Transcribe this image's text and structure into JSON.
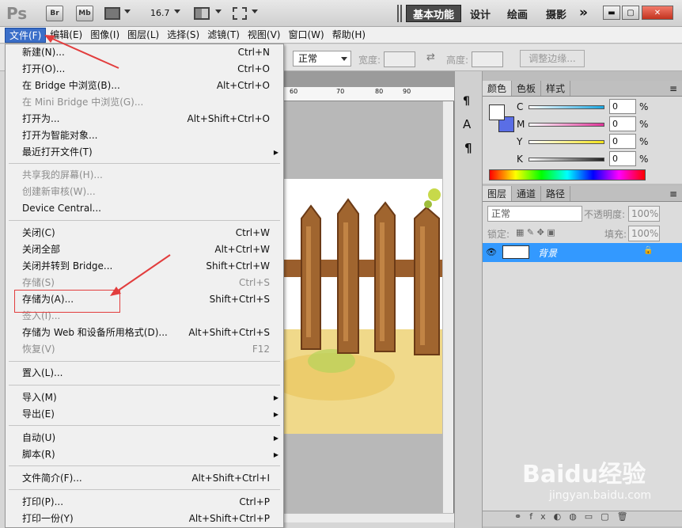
{
  "app": {
    "logo": "Ps",
    "buttons": [
      "Br",
      "Mb"
    ],
    "zoom": "16.7",
    "workspaces": [
      "基本功能",
      "设计",
      "绘画",
      "摄影"
    ],
    "more": "»"
  },
  "menubar": [
    "文件(F)",
    "编辑(E)",
    "图像(I)",
    "图层(L)",
    "选择(S)",
    "滤镜(T)",
    "视图(V)",
    "窗口(W)",
    "帮助(H)"
  ],
  "options": {
    "style_value": "正常",
    "width_label": "宽度:",
    "height_label": "高度:",
    "refine_edge": "调整边缘..."
  },
  "ruler": [
    "60",
    "70",
    "80",
    "90"
  ],
  "file_menu": [
    {
      "label": "新建(N)...",
      "shortcut": "Ctrl+N"
    },
    {
      "label": "打开(O)...",
      "shortcut": "Ctrl+O"
    },
    {
      "label": "在 Bridge 中浏览(B)...",
      "shortcut": "Alt+Ctrl+O"
    },
    {
      "label": "在 Mini Bridge 中浏览(G)...",
      "shortcut": "",
      "disabled": true
    },
    {
      "label": "打开为...",
      "shortcut": "Alt+Shift+Ctrl+O"
    },
    {
      "label": "打开为智能对象...",
      "shortcut": ""
    },
    {
      "label": "最近打开文件(T)",
      "shortcut": "",
      "submenu": true
    },
    {
      "label": "共享我的屏幕(H)...",
      "shortcut": "",
      "disabled": true
    },
    {
      "label": "创建新审核(W)...",
      "shortcut": "",
      "disabled": true
    },
    {
      "label": "Device Central...",
      "shortcut": ""
    },
    {
      "label": "关闭(C)",
      "shortcut": "Ctrl+W"
    },
    {
      "label": "关闭全部",
      "shortcut": "Alt+Ctrl+W"
    },
    {
      "label": "关闭并转到 Bridge...",
      "shortcut": "Shift+Ctrl+W"
    },
    {
      "label": "存储(S)",
      "shortcut": "Ctrl+S",
      "disabled": true
    },
    {
      "label": "存储为(A)...",
      "shortcut": "Shift+Ctrl+S"
    },
    {
      "label": "签入(I)...",
      "shortcut": "",
      "disabled": true
    },
    {
      "label": "存储为 Web 和设备所用格式(D)...",
      "shortcut": "Alt+Shift+Ctrl+S"
    },
    {
      "label": "恢复(V)",
      "shortcut": "F12",
      "disabled": true
    },
    {
      "label": "置入(L)...",
      "shortcut": ""
    },
    {
      "label": "导入(M)",
      "shortcut": "",
      "submenu": true
    },
    {
      "label": "导出(E)",
      "shortcut": "",
      "submenu": true
    },
    {
      "label": "自动(U)",
      "shortcut": "",
      "submenu": true
    },
    {
      "label": "脚本(R)",
      "shortcut": "",
      "submenu": true
    },
    {
      "label": "文件简介(F)...",
      "shortcut": "Alt+Shift+Ctrl+I"
    },
    {
      "label": "打印(P)...",
      "shortcut": "Ctrl+P"
    },
    {
      "label": "打印一份(Y)",
      "shortcut": "Alt+Shift+Ctrl+P"
    }
  ],
  "color_panel": {
    "tabs": [
      "颜色",
      "色板",
      "样式"
    ],
    "channels": [
      {
        "name": "C",
        "value": "0",
        "unit": "%",
        "color": "#1aa6e0"
      },
      {
        "name": "M",
        "value": "0",
        "unit": "%",
        "color": "#e0349a"
      },
      {
        "name": "Y",
        "value": "0",
        "unit": "%",
        "color": "#f2e21a"
      },
      {
        "name": "K",
        "value": "0",
        "unit": "%",
        "color": "#222222"
      }
    ],
    "background_color": "#5a6ee6"
  },
  "layers_panel": {
    "tabs": [
      "图层",
      "通道",
      "路径"
    ],
    "blend_mode": "正常",
    "opacity_label": "不透明度:",
    "opacity_value": "100%",
    "lock_label": "锁定:",
    "fill_label": "填充:",
    "fill_value": "100%",
    "layer_name": "背景"
  },
  "watermark": {
    "brand": "Baidu经验",
    "url": "jingyan.baidu.com"
  }
}
